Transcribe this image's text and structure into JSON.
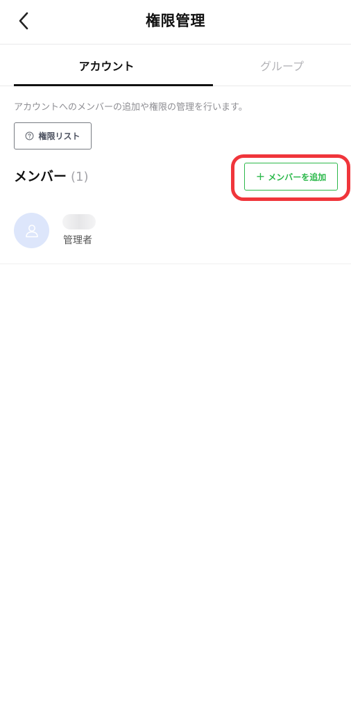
{
  "header": {
    "title": "権限管理"
  },
  "tabs": [
    {
      "label": "アカウント",
      "active": true
    },
    {
      "label": "グループ",
      "active": false
    }
  ],
  "description": "アカウントへのメンバーの追加や権限の管理を行います。",
  "permission_button": {
    "label": "権限リスト"
  },
  "members": {
    "title": "メンバー",
    "count": "(1)",
    "add_button_label": "メンバーを追加",
    "add_button_plus": "+",
    "items": [
      {
        "name": "",
        "role": "管理者"
      }
    ]
  },
  "colors": {
    "accent_green": "#2bb84a",
    "highlight_red": "#f0353b",
    "avatar_bg": "#dde6fb"
  }
}
